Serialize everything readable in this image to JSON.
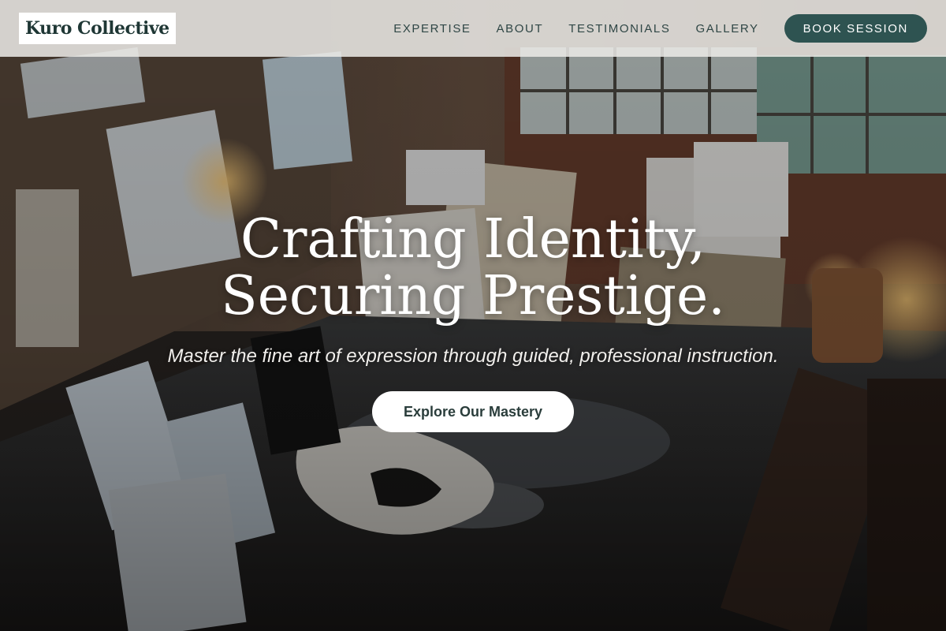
{
  "brand": {
    "name": "Kuro Collective",
    "accent_color": "#2e5351"
  },
  "nav": {
    "links": [
      {
        "label": "EXPERTISE"
      },
      {
        "label": "ABOUT"
      },
      {
        "label": "TESTIMONIALS"
      },
      {
        "label": "GALLERY"
      }
    ],
    "cta_label": "BOOK SESSION"
  },
  "hero": {
    "title_line1": "Crafting Identity,",
    "title_line2": "Securing Prestige.",
    "subtitle": "Master the fine art of expression through guided, professional instruction.",
    "cta_label": "Explore Our Mastery",
    "background": "art-studio-photo"
  }
}
